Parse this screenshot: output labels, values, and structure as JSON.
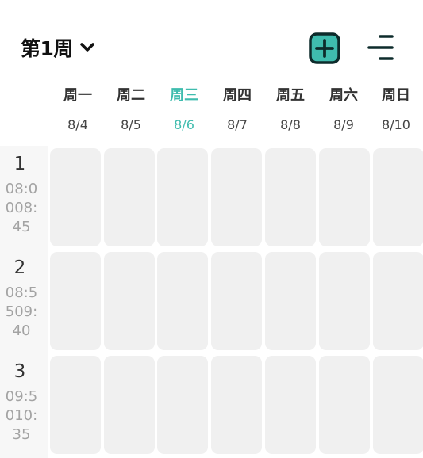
{
  "header": {
    "week_label": "第1周",
    "week_dropdown_icon": "chevron-down-icon",
    "add_icon": "plus-square-icon",
    "menu_icon": "menu-lines-icon",
    "accent_color": "#3fbcae"
  },
  "days": [
    {
      "name": "周一",
      "date": "8/4",
      "today": false
    },
    {
      "name": "周二",
      "date": "8/5",
      "today": false
    },
    {
      "name": "周三",
      "date": "8/6",
      "today": true
    },
    {
      "name": "周四",
      "date": "8/7",
      "today": false
    },
    {
      "name": "周五",
      "date": "8/8",
      "today": false
    },
    {
      "name": "周六",
      "date": "8/9",
      "today": false
    },
    {
      "name": "周日",
      "date": "8/10",
      "today": false
    }
  ],
  "periods": [
    {
      "num": "1",
      "time": "08:00\n08:45"
    },
    {
      "num": "2",
      "time": "08:55\n09:40"
    },
    {
      "num": "3",
      "time": "09:50\n10:35"
    }
  ]
}
